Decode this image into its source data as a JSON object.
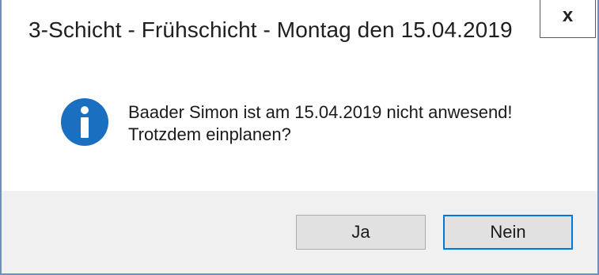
{
  "window": {
    "title": "3-Schicht - Frühschicht - Montag den 15.04.2019",
    "close_label": "x"
  },
  "message": {
    "line1": "Baader Simon ist am 15.04.2019 nicht anwesend!",
    "line2": "Trotzdem einplanen?",
    "icon": "info-icon"
  },
  "buttons": {
    "yes_label": "Ja",
    "no_label": "Nein"
  },
  "colors": {
    "accent": "#0078d7",
    "info_icon": "#1a6fc0",
    "footer_background": "#f0f0f0"
  }
}
